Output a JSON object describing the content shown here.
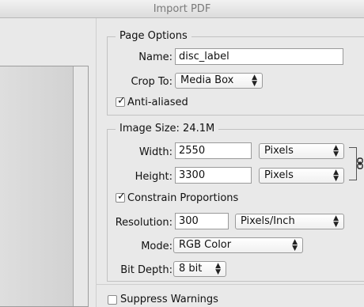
{
  "window": {
    "title": "Import PDF"
  },
  "page_options": {
    "legend": "Page Options",
    "name_label": "Name:",
    "name_value": "disc_label",
    "crop_label": "Crop To:",
    "crop_value": "Media Box",
    "anti_aliased_label": "Anti-aliased",
    "anti_aliased_checked": true
  },
  "image_size": {
    "legend": "Image Size: 24.1M",
    "width_label": "Width:",
    "width_value": "2550",
    "width_unit": "Pixels",
    "height_label": "Height:",
    "height_value": "3300",
    "height_unit": "Pixels",
    "constrain_label": "Constrain Proportions",
    "constrain_checked": true,
    "resolution_label": "Resolution:",
    "resolution_value": "300",
    "resolution_unit": "Pixels/Inch",
    "mode_label": "Mode:",
    "mode_value": "RGB Color",
    "bit_depth_label": "Bit Depth:",
    "bit_depth_value": "8 bit"
  },
  "suppress_warnings": {
    "label": "Suppress Warnings",
    "checked": false
  },
  "icons": {
    "check": "✓",
    "popup_arrows": "▲▼",
    "link": "link-icon"
  }
}
